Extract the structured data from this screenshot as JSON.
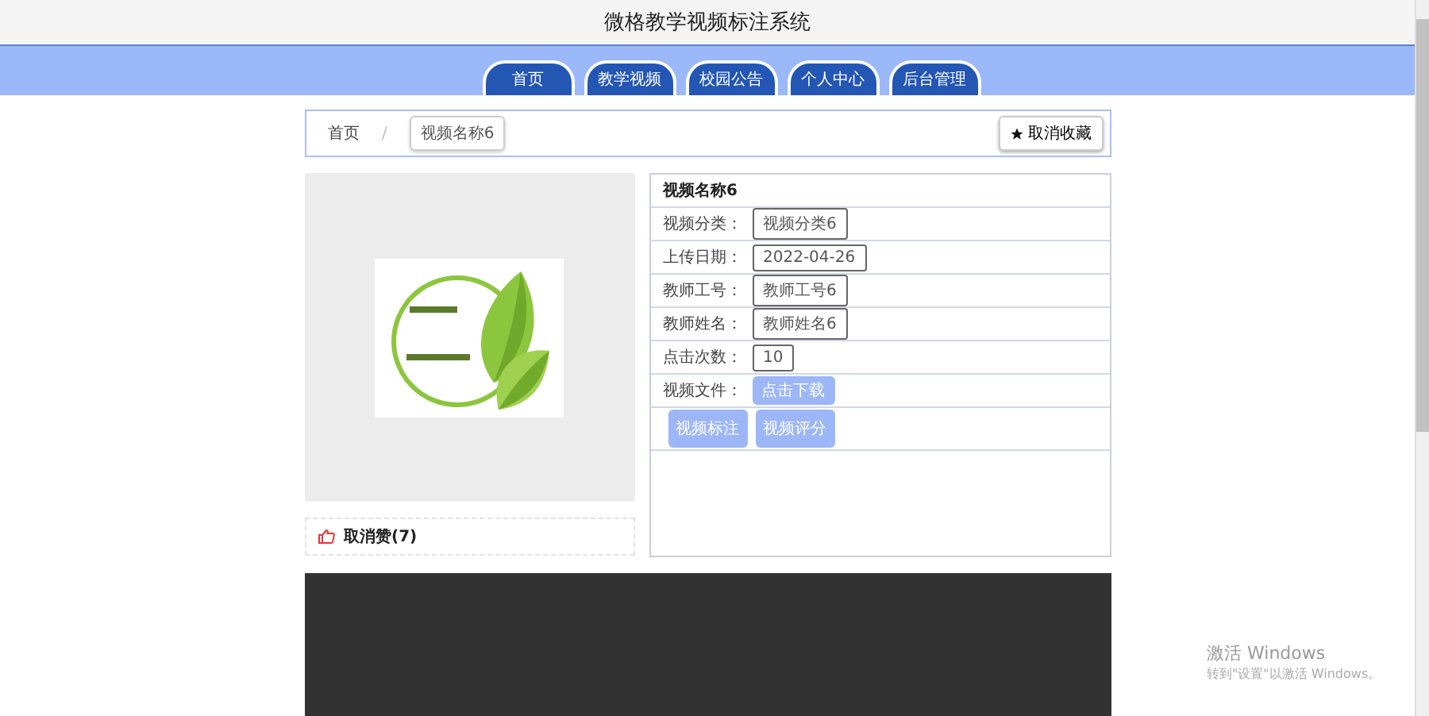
{
  "header": {
    "title": "微格教学视频标注系统"
  },
  "nav": [
    {
      "label": "首页",
      "selected": false
    },
    {
      "label": "教学视频",
      "selected": false
    },
    {
      "label": "校园公告",
      "selected": false
    },
    {
      "label": "个人中心",
      "selected": false
    },
    {
      "label": "后台管理",
      "selected": false
    }
  ],
  "breadcrumb": {
    "home": "首页",
    "separator": "/",
    "current": "视频名称6",
    "favorite_button": "取消收藏"
  },
  "like": {
    "label": "取消赞(7)"
  },
  "details": {
    "title": "视频名称6",
    "rows": [
      {
        "kind": "field",
        "label": "视频分类：",
        "value": "视频分类6"
      },
      {
        "kind": "field",
        "label": "上传日期：",
        "value": "2022-04-26"
      },
      {
        "kind": "field",
        "label": "教师工号：",
        "value": "教师工号6"
      },
      {
        "kind": "field",
        "label": "教师姓名：",
        "value": "教师姓名6"
      },
      {
        "kind": "field",
        "label": "点击次数：",
        "value": "10"
      },
      {
        "kind": "button",
        "label": "视频文件：",
        "value": "点击下载"
      }
    ],
    "actions": [
      "视频标注",
      "视频评分"
    ]
  },
  "activation": {
    "title": "激活 Windows",
    "subtitle": "转到\"设置\"以激活 Windows。"
  }
}
